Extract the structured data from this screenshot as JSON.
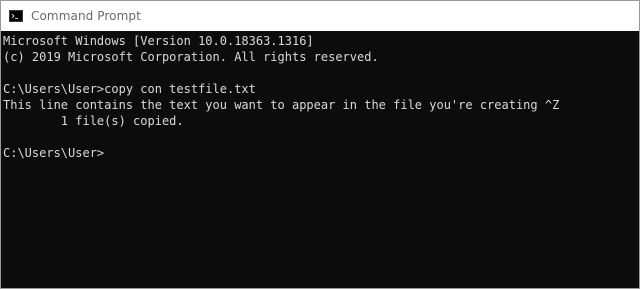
{
  "window": {
    "title": "Command Prompt",
    "icon": "cmd-icon"
  },
  "console": {
    "lines": [
      "Microsoft Windows [Version 10.0.18363.1316]",
      "(c) 2019 Microsoft Corporation. All rights reserved.",
      "",
      "C:\\Users\\User>copy con testfile.txt",
      "This line contains the text you want to appear in the file you're creating ^Z",
      "        1 file(s) copied.",
      "",
      "C:\\Users\\User>"
    ]
  },
  "colors": {
    "background": "#0c0c0c",
    "text": "#d9d9d9",
    "titlebar": "#ffffff",
    "title_text": "#6a6a6a"
  }
}
